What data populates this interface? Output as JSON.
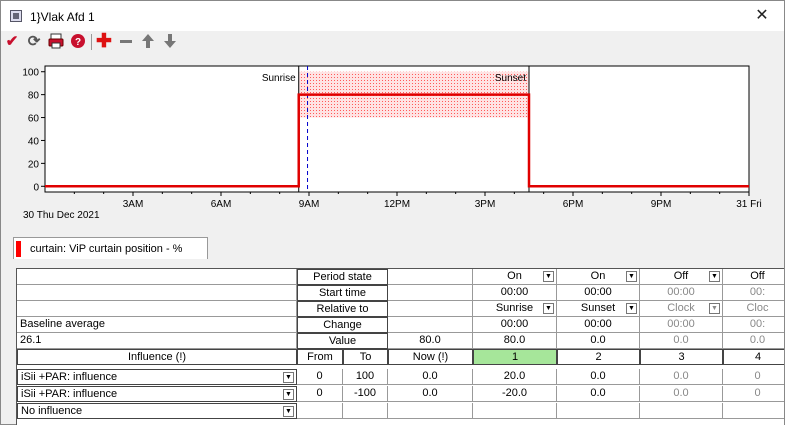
{
  "window": {
    "title": "1}Vlak Afd 1",
    "close_glyph": "✕",
    "icons": [
      "check-icon",
      "refresh-icon",
      "print-icon",
      "help-icon",
      "add-icon",
      "remove-icon",
      "arrow-up-icon",
      "arrow-down-icon"
    ]
  },
  "chart": {
    "date_label": "30 Thu Dec 2021",
    "y_ticks": [
      "0",
      "20",
      "40",
      "60",
      "80",
      "100"
    ],
    "x_ticks": [
      "3AM",
      "6AM",
      "9AM",
      "12PM",
      "3PM",
      "6PM",
      "9PM",
      "31 Fri"
    ],
    "sunrise_label": "Sunrise",
    "sunset_label": "Sunset",
    "colors": {
      "line": "#e00000",
      "band": "#ff9a9a",
      "now": "#0000cc"
    }
  },
  "chart_data": {
    "type": "line",
    "x_unit": "hour of day",
    "y_range": [
      -5,
      105
    ],
    "x_range": [
      0,
      24
    ],
    "series": [
      {
        "x": [
          0,
          8.65,
          8.65,
          16.5,
          16.5,
          24
        ],
        "y": [
          0,
          0,
          80,
          80,
          0,
          0
        ]
      }
    ],
    "band": {
      "x_start": 8.65,
      "x_end": 16.5,
      "y_low": 60,
      "y_high": 100
    },
    "now_x": 8.95,
    "sunrise_x": 8.65,
    "sunset_x": 16.5
  },
  "tab": {
    "label": "curtain: ViP curtain position - %",
    "color": "#ff0000"
  },
  "grid": {
    "labels": {
      "period_state": "Period state",
      "start_time": "Start time",
      "relative_to": "Relative to",
      "change": "Change",
      "value": "Value",
      "influence": "Influence (!)",
      "from": "From",
      "to": "To",
      "now": "Now (!)",
      "baseline_average": "Baseline average",
      "baseline_value": "26.1",
      "value_now": "80.0"
    },
    "periods": [
      {
        "state": "On",
        "start": "00:00",
        "relative": "Sunrise",
        "change": "00:00",
        "value": "80.0",
        "number": "1",
        "inf1": "20.0",
        "inf2": "-20.0",
        "enabled": true
      },
      {
        "state": "On",
        "start": "00:00",
        "relative": "Sunset",
        "change": "00:00",
        "value": "0.0",
        "number": "2",
        "inf1": "0.0",
        "inf2": "0.0",
        "enabled": true
      },
      {
        "state": "Off",
        "start": "00:00",
        "relative": "Clock",
        "change": "00:00",
        "value": "0.0",
        "number": "3",
        "inf1": "0.0",
        "inf2": "0.0",
        "enabled": false
      },
      {
        "state": "Off",
        "start": "00:",
        "relative": "Cloc",
        "change": "00:",
        "value": "0.0",
        "number": "4",
        "inf1": "0",
        "inf2": "0",
        "enabled": false
      }
    ],
    "influences": [
      {
        "name": "iSii +PAR: influence",
        "from": "0",
        "to": "100",
        "now": "0.0"
      },
      {
        "name": "iSii +PAR: influence",
        "from": "0",
        "to": "-100",
        "now": "0.0"
      },
      {
        "name": "No influence",
        "from": "",
        "to": "",
        "now": ""
      }
    ]
  }
}
